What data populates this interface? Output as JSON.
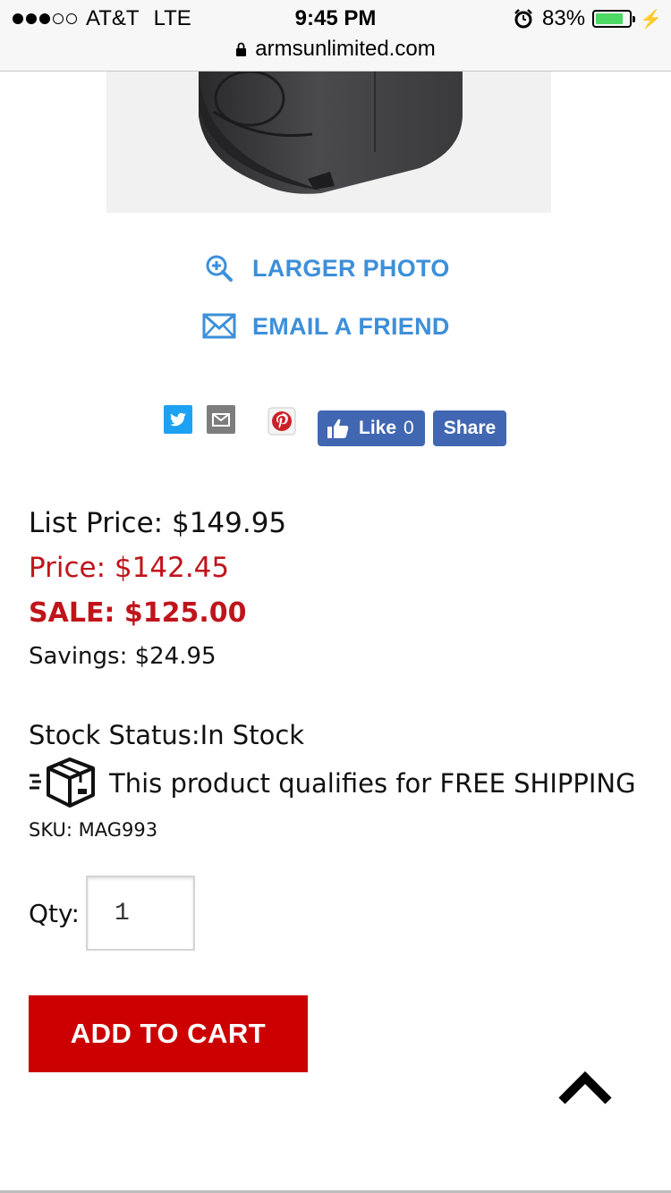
{
  "status_bar": {
    "carrier": "AT&T",
    "network": "LTE",
    "time": "9:45 PM",
    "battery_percent": "83%",
    "battery_level": 0.83,
    "signal_bars_filled": 3,
    "signal_bars_total": 5
  },
  "browser": {
    "url": "armsunlimited.com"
  },
  "product_actions": {
    "larger_photo": "LARGER PHOTO",
    "email_friend": "EMAIL A FRIEND"
  },
  "share": {
    "like_label": "Like",
    "like_count": "0",
    "share_label": "Share"
  },
  "pricing": {
    "list_price": "List Price: $149.95",
    "price": "Price: $142.45",
    "sale": "SALE: $125.00",
    "savings": "Savings: $24.95"
  },
  "availability": {
    "stock_status": "Stock Status:In Stock",
    "shipping": "This product qualifies for FREE SHIPPING",
    "sku": "SKU: MAG993"
  },
  "purchase": {
    "qty_label": "Qty:",
    "qty_value": "1",
    "add_to_cart": "ADD TO CART"
  },
  "colors": {
    "link_blue": "#3d8fd9",
    "sale_red": "#c0141b",
    "cart_red": "#cc0000",
    "facebook_blue": "#4267b2",
    "twitter_blue": "#1da1f2"
  }
}
